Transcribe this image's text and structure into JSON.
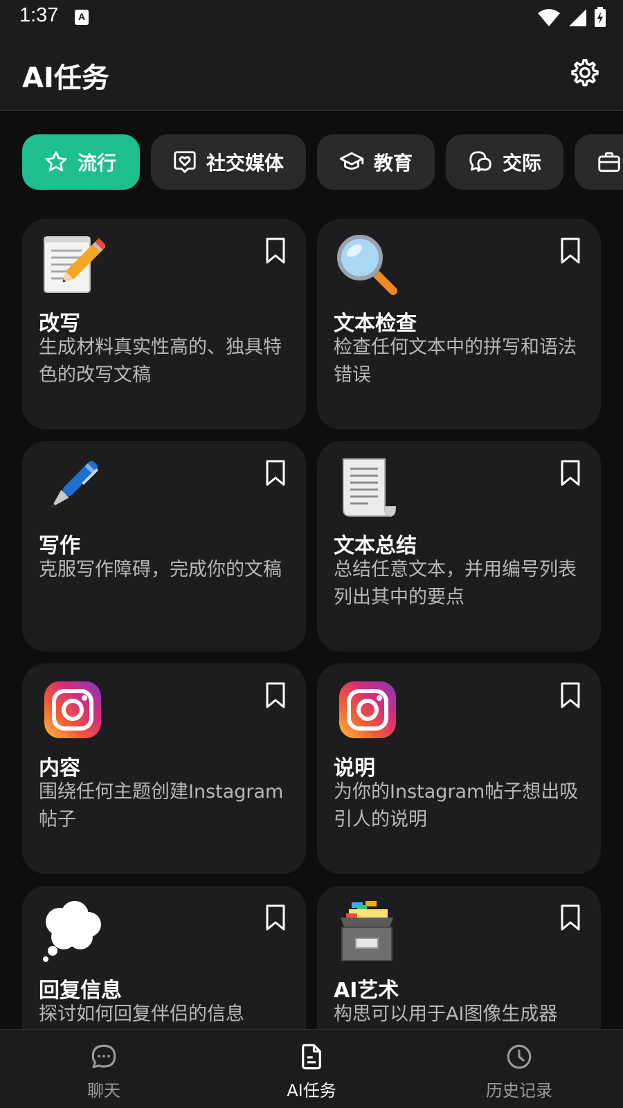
{
  "status_bar": {
    "time": "1:37",
    "notif_letter": "A"
  },
  "app_bar": {
    "title": "AI任务"
  },
  "chips": [
    {
      "label": "流行",
      "icon": "star-icon",
      "active": true
    },
    {
      "label": "社交媒体",
      "icon": "heart-bubble-icon",
      "active": false
    },
    {
      "label": "教育",
      "icon": "graduation-cap-icon",
      "active": false
    },
    {
      "label": "交际",
      "icon": "chat-bubbles-icon",
      "active": false
    },
    {
      "label": "",
      "icon": "briefcase-icon",
      "active": false
    }
  ],
  "cards": [
    {
      "title": "改写",
      "desc": "生成材料真实性高的、独具特色的改写文稿",
      "icon": "memo-icon"
    },
    {
      "title": "文本检查",
      "desc": "检查任何文本中的拼写和语法错误",
      "icon": "magnifier-icon"
    },
    {
      "title": "写作",
      "desc": "克服写作障碍，完成你的文稿",
      "icon": "pen-icon"
    },
    {
      "title": "文本总结",
      "desc": "总结任意文本，并用编号列表列出其中的要点",
      "icon": "scroll-icon"
    },
    {
      "title": "内容",
      "desc": "围绕任何主题创建Instagram帖子",
      "icon": "instagram-icon"
    },
    {
      "title": "说明",
      "desc": "为你的Instagram帖子想出吸引人的说明",
      "icon": "instagram-icon"
    },
    {
      "title": "回复信息",
      "desc": "探讨如何回复伴侣的信息",
      "icon": "thought-bubble-icon"
    },
    {
      "title": "AI艺术",
      "desc": "构思可以用于AI图像生成器",
      "icon": "card-file-box-icon"
    }
  ],
  "bottom_nav": [
    {
      "label": "聊天",
      "icon": "chat-icon",
      "active": false
    },
    {
      "label": "AI任务",
      "icon": "document-icon",
      "active": true
    },
    {
      "label": "历史记录",
      "icon": "clock-icon",
      "active": false
    }
  ],
  "colors": {
    "accent": "#1dbf8f",
    "background": "#0e0e0f",
    "card": "#1d1d1f",
    "chip": "#2a2a2c"
  }
}
